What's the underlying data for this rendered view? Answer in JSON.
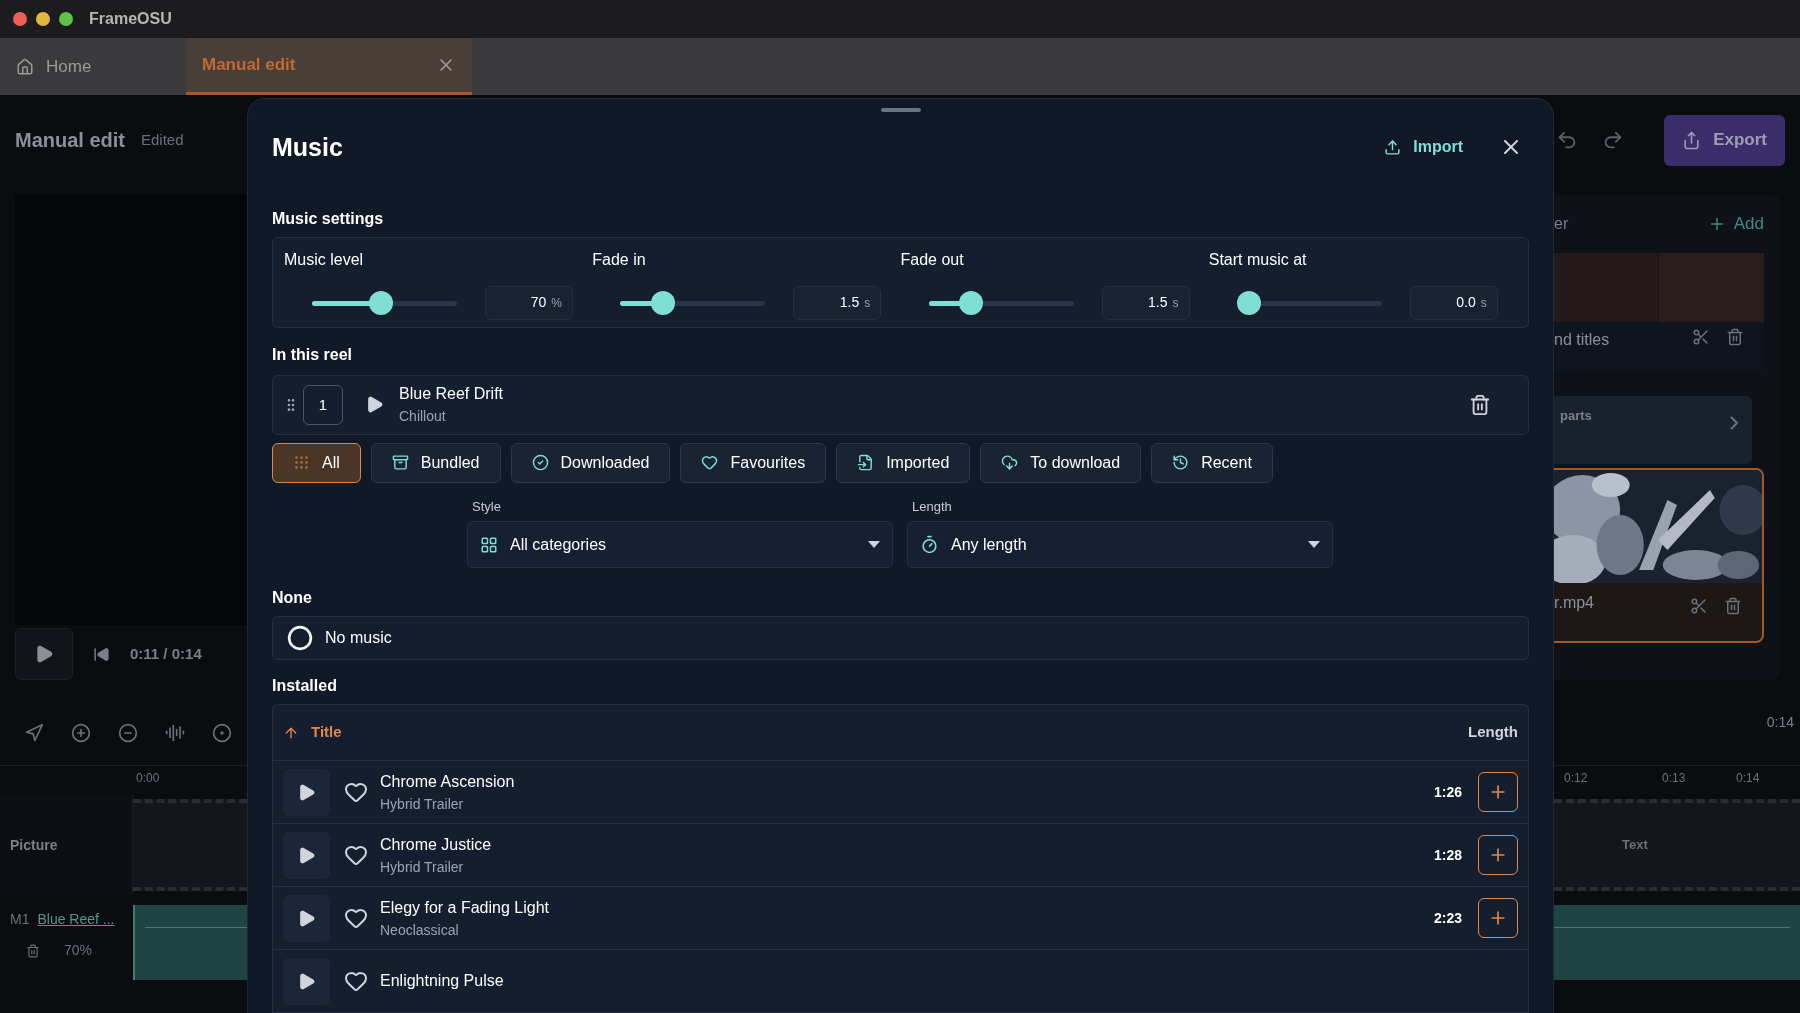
{
  "window": {
    "title": "FrameOSU"
  },
  "tabs": [
    {
      "label": "Home",
      "selected": false
    },
    {
      "label": "Manual edit",
      "selected": true
    }
  ],
  "editor": {
    "title": "Manual edit",
    "status": "Edited",
    "time": "0:11 / 0:14",
    "export": "Export",
    "panel_title": "er",
    "add": "Add",
    "clips": [
      {
        "kind": "titles",
        "label": "nd titles"
      },
      {
        "kind": "picture",
        "label": "r.mp4"
      }
    ],
    "parts": "parts",
    "end_time": "0:14",
    "ruler_left": [
      "0:00"
    ],
    "ruler_right": [
      "0:12",
      "0:13",
      "0:14"
    ],
    "picture_track": {
      "label": "Picture",
      "clip": "Text"
    },
    "music_track": {
      "id": "M1",
      "name": "Blue Reef ...",
      "volume": "70%"
    }
  },
  "music_dialog": {
    "title": "Music",
    "import": "Import",
    "settings_heading": "Music settings",
    "settings": [
      {
        "label": "Music level",
        "level": 0.47,
        "value": "70",
        "unit": "%"
      },
      {
        "label": "Fade in",
        "level": 0.25,
        "value": "1.5",
        "unit": "s"
      },
      {
        "label": "Fade out",
        "level": 0.25,
        "value": "1.5",
        "unit": "s"
      },
      {
        "label": "Start music at",
        "level": 0,
        "value": "0.0",
        "unit": "s"
      }
    ],
    "reel_heading": "In this reel",
    "reel": [
      {
        "index": "1",
        "title": "Blue Reef Drift",
        "genre": "Chillout"
      }
    ],
    "filters": [
      {
        "label": "All",
        "selected": true
      },
      {
        "label": "Bundled",
        "selected": false
      },
      {
        "label": "Downloaded",
        "selected": false
      },
      {
        "label": "Favourites",
        "selected": false
      },
      {
        "label": "Imported",
        "selected": false
      },
      {
        "label": "To download",
        "selected": false
      },
      {
        "label": "Recent",
        "selected": false
      }
    ],
    "style": {
      "label": "Style",
      "value": "All categories"
    },
    "length": {
      "label": "Length",
      "value": "Any length"
    },
    "none_heading": "None",
    "no_music": {
      "label": "No music",
      "selected": false
    },
    "installed_heading": "Installed",
    "columns": [
      {
        "label": "Title",
        "sorted": true
      },
      {
        "label": "Length",
        "sorted": false
      }
    ],
    "tracks": [
      {
        "title": "Chrome Ascension",
        "genre": "Hybrid Trailer",
        "length": "1:26",
        "favourite": false
      },
      {
        "title": "Chrome Justice",
        "genre": "Hybrid Trailer",
        "length": "1:28",
        "favourite": false
      },
      {
        "title": "Elegy for a Fading Light",
        "genre": "Neoclassical",
        "length": "2:23",
        "favourite": false
      },
      {
        "title": "Enlightning Pulse",
        "favourite": false
      }
    ]
  }
}
